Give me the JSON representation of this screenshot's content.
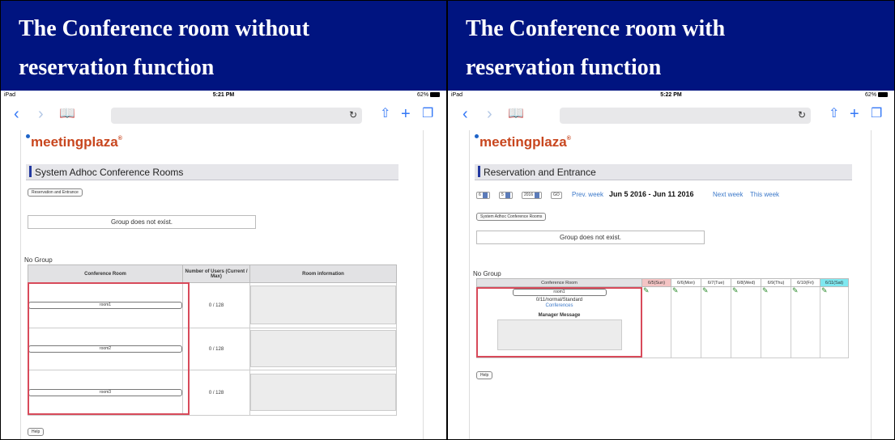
{
  "left": {
    "banner": [
      "The Conference room without",
      "reservation function"
    ],
    "status": {
      "device": "iPad",
      "time": "5:21 PM",
      "battery": "62%"
    },
    "logo": "meetingplaza",
    "section_title": "System Adhoc Conference Rooms",
    "reservation_button": "Reservation and Entrance",
    "group_message": "Group does not exist.",
    "no_group": "No Group",
    "table_headers": {
      "room": "Conference Room",
      "users": "Number of Users (Current / Max)",
      "info": "Room information"
    },
    "rooms": [
      {
        "name": "room1",
        "users": "0 / 128"
      },
      {
        "name": "room2",
        "users": "0 / 128"
      },
      {
        "name": "room3",
        "users": "0 / 128"
      }
    ],
    "help_button": "Help"
  },
  "right": {
    "banner": [
      "The Conference room with",
      "reservation function"
    ],
    "status": {
      "device": "iPad",
      "time": "5:22 PM",
      "battery": "62%"
    },
    "logo": "meetingplaza",
    "section_title": "Reservation and Entrance",
    "nav": {
      "month": "6",
      "day": "5",
      "year": "2016",
      "go": "GO",
      "prev_week": "Prev. week",
      "range": "Jun 5 2016 - Jun 11 2016",
      "next_week": "Next week",
      "this_week": "This week"
    },
    "adhoc_button": "System Adhoc Conference Rooms",
    "group_message": "Group does not exist.",
    "no_group": "No Group",
    "table_header_room": "Conference Room",
    "days": [
      "6/5(Sun)",
      "6/6(Mon)",
      "6/7(Tue)",
      "6/8(Wed)",
      "6/9(Thu)",
      "6/10(Fri)",
      "6/11(Sat)"
    ],
    "room": {
      "name": "room1",
      "details": "0/11/normal/Standard",
      "conferences": "Conferences",
      "manager_message": "Manager Message"
    },
    "help_button": "Help"
  },
  "colors": {
    "banner": "#001480",
    "sunday": "#f4c4c4",
    "saturday": "#7fe8f0",
    "highlight": "#d84a5a",
    "link": "#3b78c9"
  }
}
